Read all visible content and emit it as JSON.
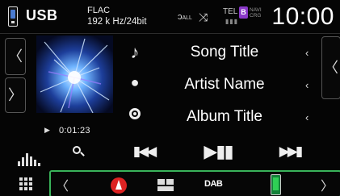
{
  "status_bar": {
    "source_label": "USB",
    "format_codec": "FLAC",
    "format_detail": "192 k Hz/24bit",
    "repeat_icon": "repeat-all-icon",
    "repeat_label": "ALL",
    "shuffle_icon": "shuffle-icon",
    "tel_label": "TEL",
    "bt_glyph": "B",
    "tiny_label_1": "NAVI",
    "tiny_label_2": "CRG",
    "clock": "10:00"
  },
  "track": {
    "song_title": "Song Title",
    "artist_name": "Artist Name",
    "album_title": "Album Title",
    "elapsed_time": "0:01:23",
    "play_state_icon": "play-icon"
  },
  "controls": {
    "eq_icon": "equalizer-icon",
    "search_icon": "search-icon",
    "prev_icon": "previous-track-icon",
    "playpause_icon": "play-pause-icon",
    "next_icon": "next-track-icon"
  },
  "side_nav": {
    "left_up_glyph": "〈",
    "left_down_glyph": "〉",
    "right_glyph": "〈",
    "info_arrow_glyph": "‹"
  },
  "shortcut_bar": {
    "left_glyph": "〈",
    "right_glyph": "〉",
    "dab_label": "DAB",
    "items": [
      "navigation-icon",
      "tiles-icon",
      "dab-icon",
      "phone-icon"
    ]
  },
  "colors": {
    "accent_green": "#39b35a",
    "bt_purple": "#8a38c8",
    "nav_red": "#d22222"
  }
}
